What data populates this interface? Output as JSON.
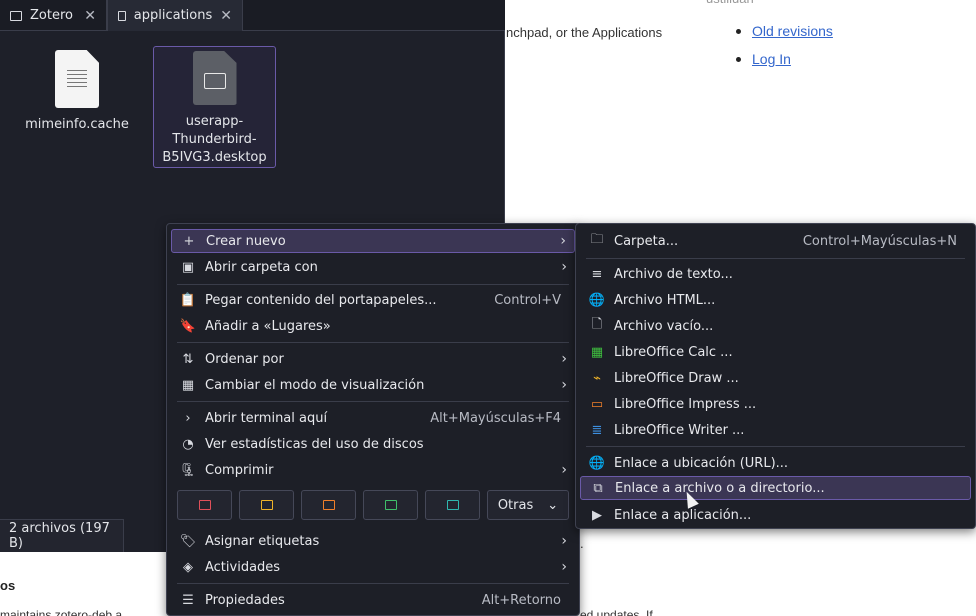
{
  "web": {
    "faded_top": "ustiliuan",
    "launch_text": "nchpad, or the Applications",
    "links": [
      "Old revisions",
      "Log In"
    ],
    "os_fragment": "os",
    "bottom_text": "maintains  zotero-deb  a",
    "bottom_text_right": "ed updates. If",
    "dot": "."
  },
  "file_manager": {
    "tabs": [
      {
        "label": "Zotero",
        "icon": "folder-icon",
        "close": "✕"
      },
      {
        "label": "applications",
        "icon": "folder-icon",
        "close": "✕",
        "active": true
      }
    ],
    "files": [
      {
        "name": "mimeinfo.cache",
        "icon": "text-file-icon"
      },
      {
        "name": "userapp-Thunderbird-B5IVG3.desktop",
        "name_lines": [
          "userapp-",
          "Thunderbird-",
          "B5IVG3.desktop"
        ],
        "icon": "desktop-file-icon",
        "selected": true
      }
    ],
    "status": "2 archivos (197 B)"
  },
  "context_menu": {
    "items": [
      {
        "label": "Crear nuevo",
        "icon": "+",
        "submenu": true,
        "highlighted": true
      },
      {
        "label": "Abrir carpeta con",
        "icon": "▣",
        "submenu": true
      },
      {
        "label": "Pegar contenido del portapapeles...",
        "icon": "📋",
        "shortcut": "Control+V"
      },
      {
        "label": "Añadir a «Lugares»",
        "icon": "🔖"
      },
      {
        "label": "Ordenar por",
        "icon": "⇅",
        "submenu": true
      },
      {
        "label": "Cambiar el modo de visualización",
        "icon": "▦",
        "submenu": true
      },
      {
        "label": "Abrir terminal aquí",
        "icon": "›",
        "shortcut": "Alt+Mayúsculas+F4"
      },
      {
        "label": "Ver estadísticas del uso de discos",
        "icon": "◔"
      },
      {
        "label": "Comprimir",
        "icon": "🗜",
        "submenu": true
      },
      {
        "label": "Asignar etiquetas",
        "icon": "🏷",
        "submenu": true
      },
      {
        "label": "Actividades",
        "icon": "◈",
        "submenu": true
      },
      {
        "label": "Propiedades",
        "icon": "☰",
        "shortcut": "Alt+Retorno"
      }
    ],
    "color_folders": [
      "#e0505a",
      "#f0b429",
      "#f07f2a",
      "#3fbf6a",
      "#2fb8b0"
    ],
    "otras_label": "Otras"
  },
  "submenu": {
    "items": [
      {
        "label": "Carpeta...",
        "icon": "🗀",
        "shortcut": "Control+Mayúsculas+N"
      },
      {
        "label": "Archivo de texto...",
        "icon": "≡"
      },
      {
        "label": "Archivo HTML...",
        "icon": "🌐"
      },
      {
        "label": "Archivo vacío...",
        "icon": "🗋"
      },
      {
        "label": "LibreOffice Calc  ...",
        "icon": "▦",
        "color": "#3fbf3f"
      },
      {
        "label": "LibreOffice Draw  ...",
        "icon": "⌁",
        "color": "#f0b429"
      },
      {
        "label": "LibreOffice Impress  ...",
        "icon": "▭",
        "color": "#f07f2a"
      },
      {
        "label": "LibreOffice Writer  ...",
        "icon": "≣",
        "color": "#3d8fe0"
      },
      {
        "label": "Enlace a ubicación (URL)...",
        "icon": "🌐"
      },
      {
        "label": "Enlace a archivo o a directorio...",
        "icon": "⧉",
        "highlighted": true
      },
      {
        "label": "Enlace a aplicación...",
        "icon": "▶"
      }
    ]
  }
}
